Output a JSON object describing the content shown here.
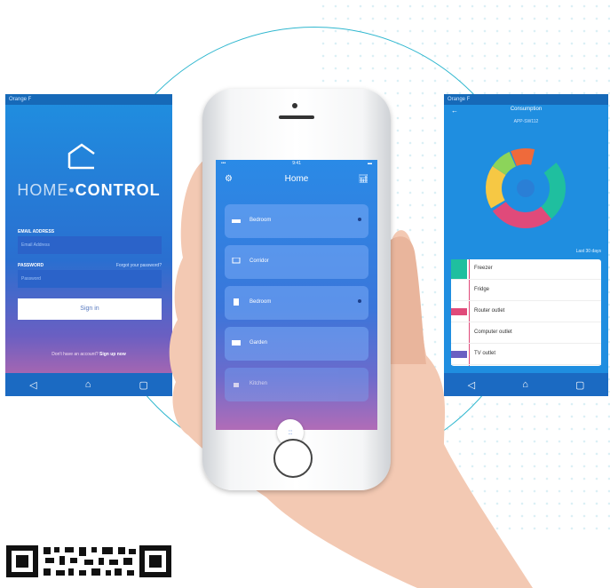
{
  "left_screen": {
    "status_text": "Orange F",
    "brand_thin": "HOME",
    "brand_separator": "•",
    "brand_bold": "CONTROL",
    "email_label": "EMAIL ADDRESS",
    "email_placeholder": "Email Address",
    "password_label": "PASSWORD",
    "forgot_label": "Forgot your password?",
    "password_placeholder": "Password",
    "signin_label": "Sign in",
    "signup_prefix": "Don't have an account?",
    "signup_link": "Sign up now",
    "nav": {
      "back": "◁",
      "home": "⌂",
      "recent": "▢"
    }
  },
  "center_screen": {
    "time": "9:41",
    "title": "Home",
    "rooms": [
      {
        "label": "Bedroom"
      },
      {
        "label": "Corridor"
      },
      {
        "label": "Bedroom"
      },
      {
        "label": "Garden"
      },
      {
        "label": "Kitchen"
      }
    ],
    "fab": "::"
  },
  "right_screen": {
    "status_text": "Orange F",
    "title": "Consumption",
    "subtitle": "APP-SW112",
    "last_label": "Last 30 days",
    "apps": [
      {
        "name": "Freezer",
        "value": "",
        "color": "#1fbf9f"
      },
      {
        "name": "Fridge",
        "value": "",
        "color": "#ffffff"
      },
      {
        "name": "Router outlet",
        "value": "",
        "color": "#e04a7a"
      },
      {
        "name": "Computer outlet",
        "value": "",
        "color": "#ffffff"
      },
      {
        "name": "TV outlet",
        "value": "",
        "color": "#6a5fc2"
      }
    ],
    "nav": {
      "back": "◁",
      "home": "⌂",
      "recent": "▢"
    }
  },
  "colors": {
    "ring": "#2fb7cf",
    "donut": [
      "#1fbf9f",
      "#1f8ee0",
      "#e04a7a",
      "#f6c844",
      "#ef6a3b",
      "#8cd45a"
    ]
  }
}
